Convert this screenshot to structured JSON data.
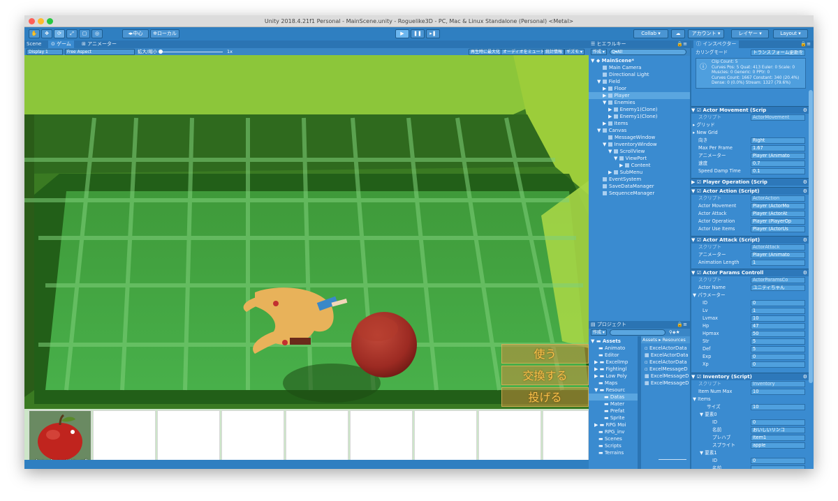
{
  "window": {
    "title": "Unity 2018.4.21f1 Personal - MainScene.unity - Roguelike3D - PC, Mac & Linux Standalone (Personal) <Metal>"
  },
  "toolbar": {
    "pivot_label": "中心",
    "space_label": "ローカル",
    "collab_label": "Collab ▾",
    "account_label": "アカウント ▾",
    "layers_label": "レイヤー ▾",
    "layout_label": "Layout ▾"
  },
  "game_panel": {
    "tab_scene": "Scene",
    "tab_game": "ゲーム",
    "tab_animator": "アニメーター",
    "display": "Display 1",
    "aspect": "Free Aspect",
    "scale_label": "拡大/縮小",
    "scale_value": "1x",
    "maximize_on_play": "再生時に最大化",
    "mute_audio": "オーディオをミュート",
    "stats": "統計情報",
    "gizmos": "ギズモ ▾"
  },
  "game_view": {
    "menu_use": "使う",
    "menu_swap": "交換する",
    "menu_throw": "投げる",
    "slot1_label": "おいしいリンゴ",
    "slot_count": 9
  },
  "hierarchy": {
    "tab_label": "ヒエラルキー",
    "create_label": "作成 ▾",
    "search_placeholder": "Q▾All",
    "items": [
      {
        "label": "MainScene*",
        "depth": 0
      },
      {
        "label": "Main Camera",
        "depth": 1
      },
      {
        "label": "Directional Light",
        "depth": 1
      },
      {
        "label": "Field",
        "depth": 1
      },
      {
        "label": "Floor",
        "depth": 2
      },
      {
        "label": "Player",
        "depth": 2
      },
      {
        "label": "Enemies",
        "depth": 2
      },
      {
        "label": "Enemy1(Clone)",
        "depth": 3
      },
      {
        "label": "Enemy1(Clone)",
        "depth": 3
      },
      {
        "label": "Items",
        "depth": 2
      },
      {
        "label": "Canvas",
        "depth": 1
      },
      {
        "label": "MessageWindow",
        "depth": 2
      },
      {
        "label": "InventoryWindow",
        "depth": 2
      },
      {
        "label": "ScrollView",
        "depth": 3
      },
      {
        "label": "ViewPort",
        "depth": 4
      },
      {
        "label": "Content",
        "depth": 5
      },
      {
        "label": "SubMenu",
        "depth": 3
      },
      {
        "label": "EventSystem",
        "depth": 1
      },
      {
        "label": "SaveDataManager",
        "depth": 1
      },
      {
        "label": "SequenceManager",
        "depth": 1
      }
    ]
  },
  "project": {
    "tab_label": "プロジェクト",
    "create_label": "作成 ▾",
    "breadcrumb_assets": "Assets",
    "breadcrumb_resources": "Resources",
    "folders": [
      "Assets",
      "Animato",
      "Editor",
      "ExcelImp",
      "Fightingl",
      "Low Poly",
      "Maps",
      "Resourc",
      "Datas",
      "Mater",
      "Prefat",
      "Sprite",
      "RPG Moi",
      "RPG_inv",
      "Scenes",
      "Scripts",
      "Terrains"
    ],
    "files": [
      "ExcelActorData",
      "ExcelActorData",
      "ExcelActorData",
      "ExcelMessageD",
      "ExcelMessageD",
      "ExcelMessageD"
    ]
  },
  "inspector": {
    "tab_label": "インスペクター",
    "culling_label": "カリングモード",
    "culling_value": "トランスフォーム更新を",
    "info_lines": [
      "Clip Count: 5",
      "Curves Pos: 5 Quat: 413 Euler: 0 Scale: 0",
      "Muscles: 0 Generic: 0 PPtr: 0",
      "Curves Count: 1667 Constant: 340 (20.4%)",
      "Dense: 0 (0.0%) Stream: 1327 (79.6%)"
    ],
    "actor_movement": {
      "title": "Actor Movement (Scrip",
      "script_label": "スクリプト",
      "script_value": "ActorMovement",
      "grid_label": "グリッド",
      "new_grid_label": "New Grid",
      "direction_label": "向き",
      "direction_value": "Right",
      "max_per_frame_label": "Max Per Frame",
      "max_per_frame_value": "1.67",
      "animator_label": "アニメーター",
      "animator_value": "Player (Animato",
      "speed_label": "速度",
      "speed_value": "0.7",
      "damp_label": "Speed Damp Time",
      "damp_value": "0.1"
    },
    "player_operation": {
      "title": "Player Operation (Scrip"
    },
    "actor_action": {
      "title": "Actor Action (Script)",
      "script_label": "スクリプト",
      "script_value": "ActorAction",
      "movement_label": "Actor Movement",
      "movement_value": "Player (ActorMo",
      "attack_label": "Actor Attack",
      "attack_value": "Player (ActorAt",
      "operation_label": "Actor Operation",
      "operation_value": "Player (PlayerOp",
      "use_items_label": "Actor Use Items",
      "use_items_value": "Player (ActorUs"
    },
    "actor_attack": {
      "title": "Actor Attack (Script)",
      "script_label": "スクリプト",
      "script_value": "ActorAttack",
      "animator_label": "アニメーター",
      "animator_value": "Player (Animato",
      "anim_length_label": "Animation Length",
      "anim_length_value": "1"
    },
    "actor_params": {
      "title": "Actor Params Controll",
      "script_label": "スクリプト",
      "script_value": "ActorParamsCo",
      "name_label": "Actor Name",
      "name_value": "ユニティちゃん",
      "params_label": "パラメーター",
      "rows": [
        {
          "label": "ID",
          "value": "0"
        },
        {
          "label": "Lv",
          "value": "1"
        },
        {
          "label": "Lvmax",
          "value": "10"
        },
        {
          "label": "Hp",
          "value": "47"
        },
        {
          "label": "Hpmax",
          "value": "50"
        },
        {
          "label": "Str",
          "value": "5"
        },
        {
          "label": "Def",
          "value": "5"
        },
        {
          "label": "Exp",
          "value": "0"
        },
        {
          "label": "Xp",
          "value": "0"
        }
      ]
    },
    "inventory": {
      "title": "Inventory (Script)",
      "script_label": "スクリプト",
      "script_value": "Inventory",
      "num_max_label": "Item Num Max",
      "num_max_value": "10",
      "items_label": "Items",
      "size_label": "サイズ",
      "size_value": "10",
      "elem0_label": "要素0",
      "id_label": "ID",
      "id_value": "0",
      "name_label": "名前",
      "name_value": "おいしいリンゴ",
      "prefab_label": "プレハブ",
      "prefab_value": "Item1",
      "sprite_label": "スプライト",
      "sprite_value": "apple",
      "elem1_label": "要素1",
      "id1_value": "0",
      "name1_label": "名前"
    }
  }
}
